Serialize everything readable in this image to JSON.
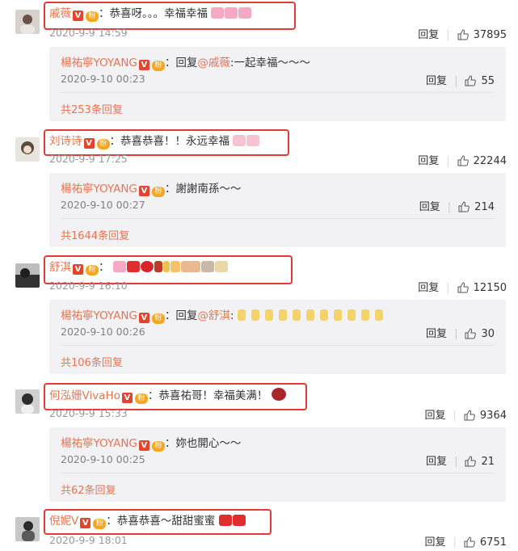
{
  "comments": [
    {
      "author": "戚薇",
      "text": "：恭喜呀。。。幸福幸福",
      "time": "2020-9-9 14:59",
      "reply_label": "回复",
      "likes": "37895",
      "reply": {
        "author": "楊祐寧YOYANG",
        "text": "：回复",
        "mention": "@戚薇",
        "text2": ":一起幸福～～～",
        "time": "2020-9-10 00:23",
        "reply_label": "回复",
        "likes": "55"
      },
      "more": "共253条回复"
    },
    {
      "author": "刘诗诗",
      "text": "：恭喜恭喜！！永远幸福",
      "time": "2020-9-9 17:25",
      "reply_label": "回复",
      "likes": "22244",
      "reply": {
        "author": "楊祐寧YOYANG",
        "text": "：謝謝南孫～～",
        "time": "2020-9-10 00:27",
        "reply_label": "回复",
        "likes": "214"
      },
      "more": "共1644条回复"
    },
    {
      "author": "舒淇",
      "text": "：",
      "time": "2020-9-9 16:10",
      "reply_label": "回复",
      "likes": "12150",
      "reply": {
        "author": "楊祐寧YOYANG",
        "text": "：回复",
        "mention": "@舒淇",
        "text2": ":",
        "time": "2020-9-10 00:26",
        "reply_label": "回复",
        "likes": "30"
      },
      "more": "共106条回复"
    },
    {
      "author": "何泓姗VivaHo",
      "text": "：恭喜祐哥！幸福美满！",
      "time": "2020-9-9 15:33",
      "reply_label": "回复",
      "likes": "9364",
      "reply": {
        "author": "楊祐寧YOYANG",
        "text": "：妳也開心～～",
        "time": "2020-9-10 00:25",
        "reply_label": "回复",
        "likes": "21"
      },
      "more": "共62条回复"
    },
    {
      "author": "倪妮V",
      "text": "：恭喜恭喜～甜甜蜜蜜",
      "time": "2020-9-9 18:01",
      "reply_label": "回复",
      "likes": "6751"
    }
  ],
  "badges": {
    "verified": "V",
    "fan": "粉"
  },
  "colors": {
    "name": "#eb7350",
    "highlight_box": "#e53935",
    "reply_bg": "#f2f2f5"
  },
  "icons": {
    "like": "thumbs-up-icon"
  }
}
